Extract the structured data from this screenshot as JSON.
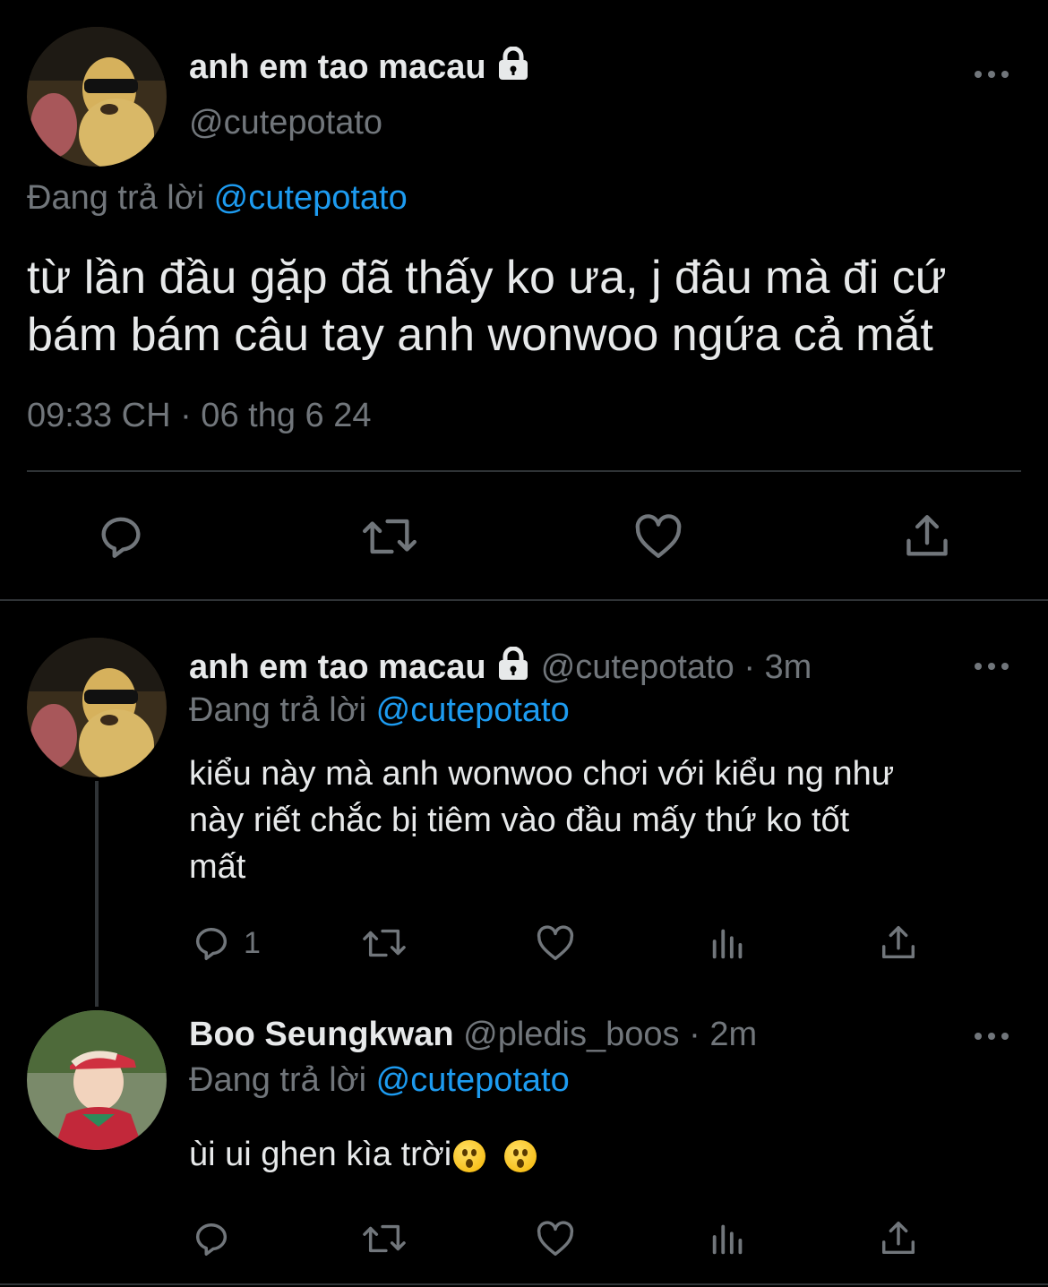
{
  "main_tweet": {
    "display_name": "anh em tao macau",
    "handle": "@cutepotato",
    "reply_prefix": "Đang trả lời",
    "reply_to": "@cutepotato",
    "text_line1": "từ lần đầu gặp đã thấy ko ưa, j đâu mà đi cứ",
    "text_line2": "bám bám câu tay anh wonwoo ngứa cả mắt",
    "timestamp": "09:33 CH · 06 thg 6 24"
  },
  "reply1": {
    "display_name": "anh em tao macau",
    "handle": "@cutepotato",
    "sep": "·",
    "time": "3m",
    "reply_prefix": "Đang trả lời",
    "reply_to": "@cutepotato",
    "text_line1": "kiểu này mà anh wonwoo chơi với kiểu ng như",
    "text_line2": "này riết chắc bị tiêm vào đầu mấy thứ ko tốt",
    "text_line3": "mất",
    "reply_count": "1"
  },
  "reply2": {
    "display_name": "Boo Seungkwan",
    "handle": "@pledis_boos",
    "sep": "·",
    "time": "2m",
    "reply_prefix": "Đang trả lời",
    "reply_to": "@cutepotato",
    "text": "ùi ui ghen kìa trời"
  },
  "colors": {
    "background": "#000000",
    "text": "#e7e9ea",
    "muted": "#71767b",
    "link": "#1d9bf0",
    "divider": "#2f3336"
  },
  "icons": [
    "lock-icon",
    "more-icon",
    "reply-icon",
    "retweet-icon",
    "like-icon",
    "share-icon",
    "views-icon",
    "emoji-astonished-icon"
  ]
}
